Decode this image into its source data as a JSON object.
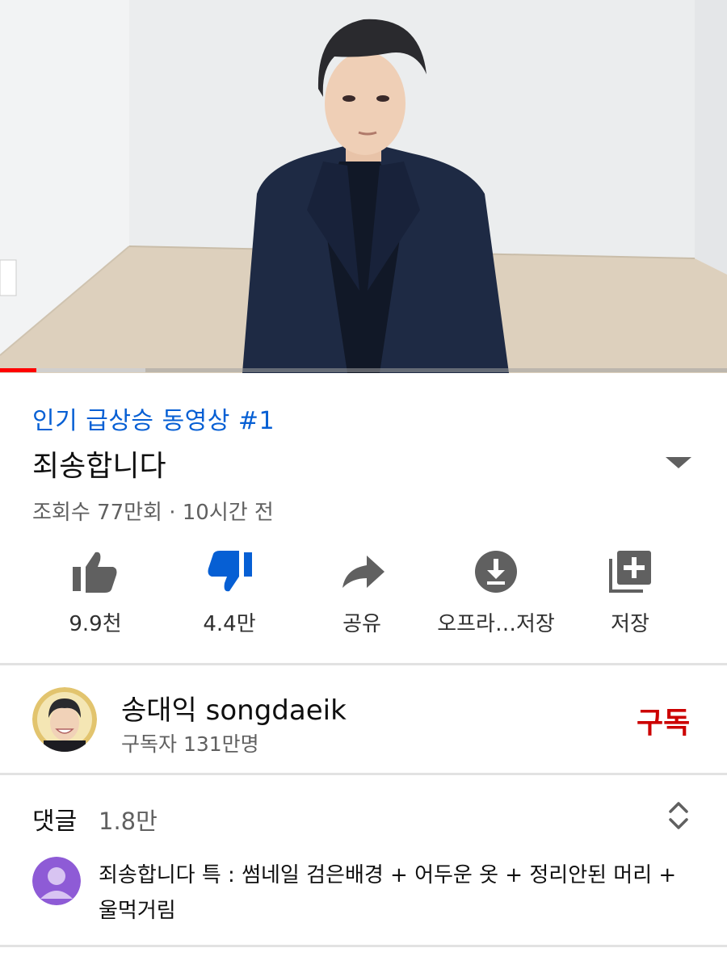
{
  "video": {
    "progress_played": 0.05,
    "progress_buffered": 0.2
  },
  "info": {
    "trending": "인기 급상승 동영상 #1",
    "title": "죄송합니다",
    "meta": "조회수 77만회 · 10시간 전"
  },
  "actions": [
    {
      "icon": "thumbs-up-icon",
      "label": "9.9천"
    },
    {
      "icon": "thumbs-down-icon",
      "label": "4.4만",
      "active_color": "#065fd4"
    },
    {
      "icon": "share-icon",
      "label": "공유"
    },
    {
      "icon": "download-icon",
      "label": "오프라…저장"
    },
    {
      "icon": "add-to-playlist-icon",
      "label": "저장"
    }
  ],
  "channel": {
    "name": "송대익 songdaeik",
    "subscribers": "구독자 131만명",
    "subscribe_label": "구독"
  },
  "comments": {
    "label": "댓글",
    "count": "1.8만",
    "top_comment": "죄송합니다 특 : 썸네일 검은배경 + 어두운 옷 + 정리안된 머리 + 울먹거림"
  },
  "colors": {
    "accent_blue": "#065fd4",
    "subscribe_red": "#cc0000",
    "progress_red": "#ff0000"
  }
}
